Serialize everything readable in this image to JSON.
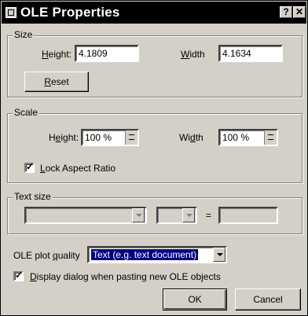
{
  "window": {
    "title": "OLE Properties",
    "help_label": "?",
    "close_label": "✕"
  },
  "size": {
    "group_title": "Size",
    "height_label": "Height:",
    "height_value": "4.1809",
    "width_label": "Width",
    "width_value": "4.1634",
    "reset_label": "Reset"
  },
  "scale": {
    "group_title": "Scale",
    "height_label": "Height:",
    "height_value": "100 %",
    "width_label": "Width",
    "width_value": "100 %",
    "lock_label": "Lock Aspect Ratio",
    "lock_checked": true
  },
  "text_size": {
    "group_title": "Text size",
    "font_value": "",
    "size_value": "",
    "equals": "=",
    "result_value": ""
  },
  "plot_quality": {
    "label": "OLE plot quality",
    "selected": "Text (e.g. text document)"
  },
  "display_dialog": {
    "label": "Display dialog when pasting new OLE objects",
    "checked": true
  },
  "buttons": {
    "ok": "OK",
    "cancel": "Cancel"
  }
}
